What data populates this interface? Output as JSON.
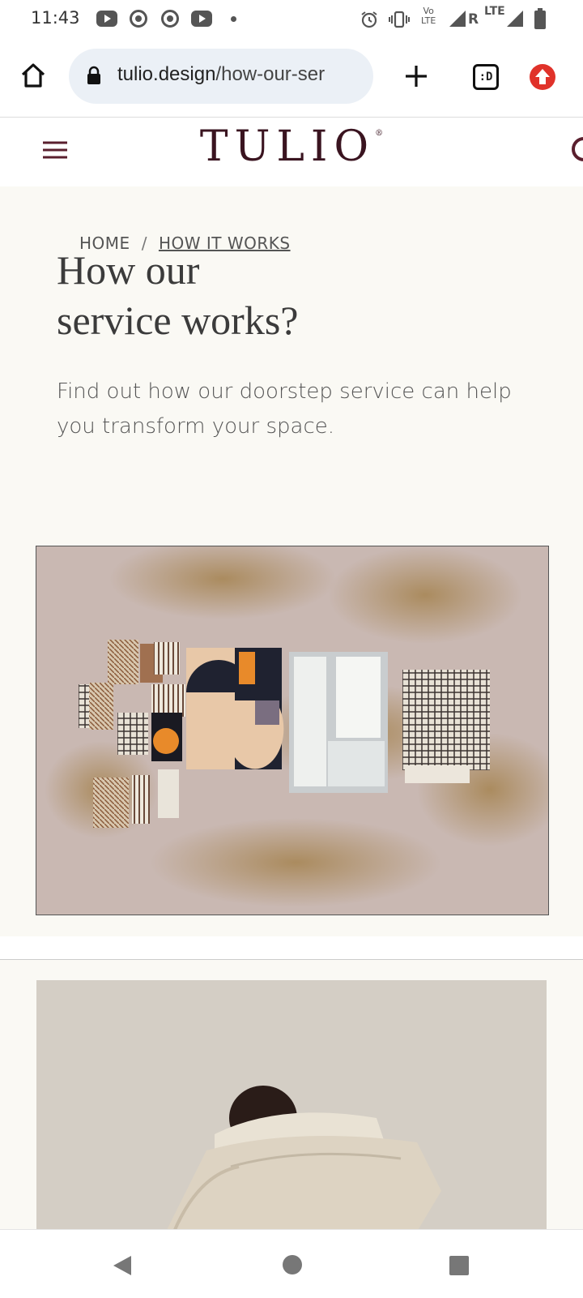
{
  "status_bar": {
    "time": "11:43",
    "network_label_top": "Vo",
    "network_label_bottom": "LTE",
    "roaming": "R",
    "lte": "LTE"
  },
  "browser": {
    "url_domain": "tulio.design",
    "url_path": "/how-our-ser",
    "tab_switcher_label": ":D"
  },
  "site": {
    "logo": "TULIO",
    "logo_mark": "®",
    "brand_color": "#3a1420"
  },
  "breadcrumb": {
    "home": "HOME",
    "separator": "/",
    "current": "HOW IT WORKS"
  },
  "hero": {
    "title_line1": "How our",
    "title_line2": "service works?",
    "subtitle": "Find out how our doorstep service can help you transform your space."
  },
  "icons": {
    "home": "home-icon",
    "lock": "lock-icon",
    "new_tab": "plus-icon",
    "update": "update-arrow-icon",
    "menu": "hamburger-menu-icon",
    "search": "search-icon",
    "back": "back-triangle-icon",
    "home_nav": "home-circle-icon",
    "recents": "recents-square-icon"
  }
}
